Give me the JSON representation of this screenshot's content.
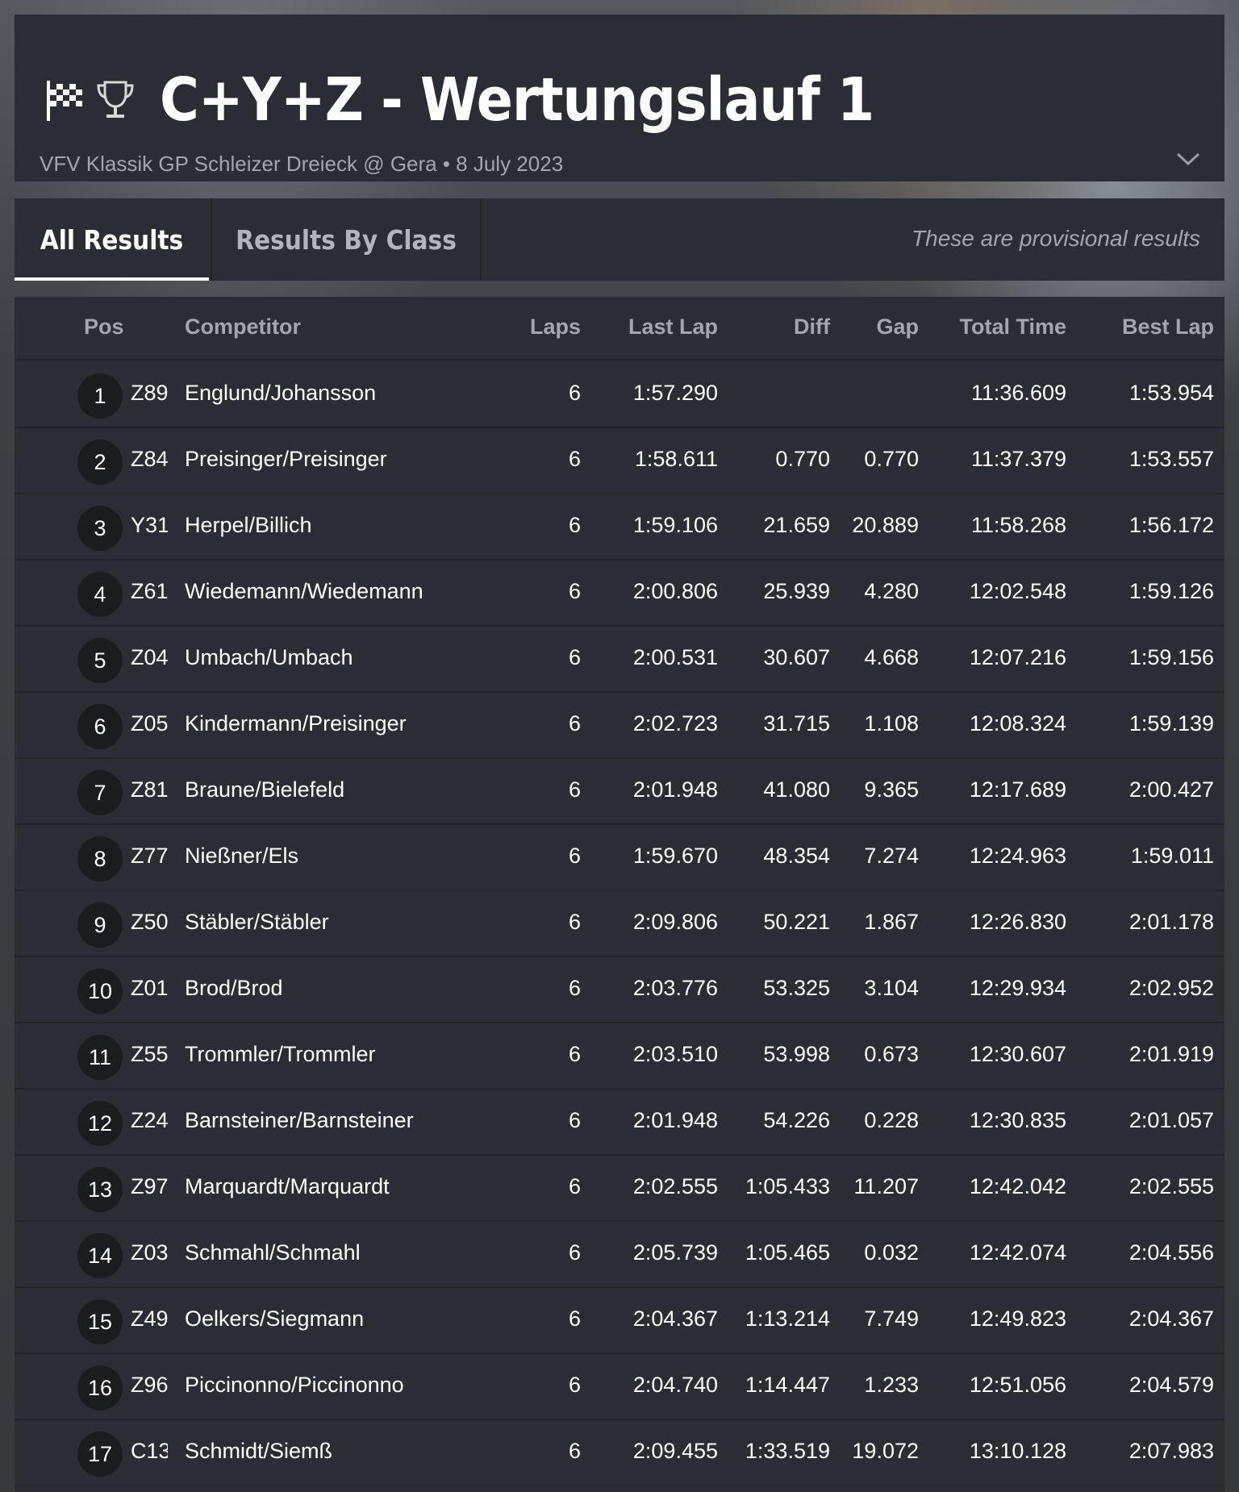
{
  "header": {
    "title": "C+Y+Z - Wertungslauf 1",
    "subtitle": "VFV Klassik GP Schleizer Dreieck @ Gera • 8 July 2023",
    "icons": [
      "checkered-flag-icon",
      "trophy-icon",
      "chevron-down-icon"
    ]
  },
  "tabs": {
    "all": "All Results",
    "by_class": "Results By Class",
    "note": "These are provisional results"
  },
  "table": {
    "columns": {
      "pos": "Pos",
      "competitor": "Competitor",
      "laps": "Laps",
      "last_lap": "Last Lap",
      "diff": "Diff",
      "gap": "Gap",
      "total": "Total Time",
      "best": "Best Lap"
    },
    "rows": [
      {
        "pos": "1",
        "num": "Z89",
        "name": "Englund/Johansson",
        "laps": "6",
        "last": "1:57.290",
        "diff": "",
        "gap": "",
        "total": "11:36.609",
        "best": "1:53.954"
      },
      {
        "pos": "2",
        "num": "Z84",
        "name": "Preisinger/Preisinger",
        "laps": "6",
        "last": "1:58.611",
        "diff": "0.770",
        "gap": "0.770",
        "total": "11:37.379",
        "best": "1:53.557"
      },
      {
        "pos": "3",
        "num": "Y31",
        "name": "Herpel/Billich",
        "laps": "6",
        "last": "1:59.106",
        "diff": "21.659",
        "gap": "20.889",
        "total": "11:58.268",
        "best": "1:56.172"
      },
      {
        "pos": "4",
        "num": "Z61",
        "name": "Wiedemann/Wiedemann",
        "laps": "6",
        "last": "2:00.806",
        "diff": "25.939",
        "gap": "4.280",
        "total": "12:02.548",
        "best": "1:59.126"
      },
      {
        "pos": "5",
        "num": "Z04",
        "name": "Umbach/Umbach",
        "laps": "6",
        "last": "2:00.531",
        "diff": "30.607",
        "gap": "4.668",
        "total": "12:07.216",
        "best": "1:59.156"
      },
      {
        "pos": "6",
        "num": "Z05",
        "name": "Kindermann/Preisinger",
        "laps": "6",
        "last": "2:02.723",
        "diff": "31.715",
        "gap": "1.108",
        "total": "12:08.324",
        "best": "1:59.139"
      },
      {
        "pos": "7",
        "num": "Z81",
        "name": "Braune/Bielefeld",
        "laps": "6",
        "last": "2:01.948",
        "diff": "41.080",
        "gap": "9.365",
        "total": "12:17.689",
        "best": "2:00.427"
      },
      {
        "pos": "8",
        "num": "Z77",
        "name": "Nießner/Els",
        "laps": "6",
        "last": "1:59.670",
        "diff": "48.354",
        "gap": "7.274",
        "total": "12:24.963",
        "best": "1:59.011"
      },
      {
        "pos": "9",
        "num": "Z50",
        "name": "Stäbler/Stäbler",
        "laps": "6",
        "last": "2:09.806",
        "diff": "50.221",
        "gap": "1.867",
        "total": "12:26.830",
        "best": "2:01.178"
      },
      {
        "pos": "10",
        "num": "Z01",
        "name": "Brod/Brod",
        "laps": "6",
        "last": "2:03.776",
        "diff": "53.325",
        "gap": "3.104",
        "total": "12:29.934",
        "best": "2:02.952"
      },
      {
        "pos": "11",
        "num": "Z55",
        "name": "Trommler/Trommler",
        "laps": "6",
        "last": "2:03.510",
        "diff": "53.998",
        "gap": "0.673",
        "total": "12:30.607",
        "best": "2:01.919"
      },
      {
        "pos": "12",
        "num": "Z24",
        "name": "Barnsteiner/Barnsteiner",
        "laps": "6",
        "last": "2:01.948",
        "diff": "54.226",
        "gap": "0.228",
        "total": "12:30.835",
        "best": "2:01.057"
      },
      {
        "pos": "13",
        "num": "Z97",
        "name": "Marquardt/Marquardt",
        "laps": "6",
        "last": "2:02.555",
        "diff": "1:05.433",
        "gap": "11.207",
        "total": "12:42.042",
        "best": "2:02.555"
      },
      {
        "pos": "14",
        "num": "Z03",
        "name": "Schmahl/Schmahl",
        "laps": "6",
        "last": "2:05.739",
        "diff": "1:05.465",
        "gap": "0.032",
        "total": "12:42.074",
        "best": "2:04.556"
      },
      {
        "pos": "15",
        "num": "Z49",
        "name": "Oelkers/Siegmann",
        "laps": "6",
        "last": "2:04.367",
        "diff": "1:13.214",
        "gap": "7.749",
        "total": "12:49.823",
        "best": "2:04.367"
      },
      {
        "pos": "16",
        "num": "Z96",
        "name": "Piccinonno/Piccinonno",
        "laps": "6",
        "last": "2:04.740",
        "diff": "1:14.447",
        "gap": "1.233",
        "total": "12:51.056",
        "best": "2:04.579"
      },
      {
        "pos": "17",
        "num": "C13",
        "name": "Schmidt/Siemß",
        "laps": "6",
        "last": "2:09.455",
        "diff": "1:33.519",
        "gap": "19.072",
        "total": "13:10.128",
        "best": "2:07.983"
      }
    ]
  }
}
